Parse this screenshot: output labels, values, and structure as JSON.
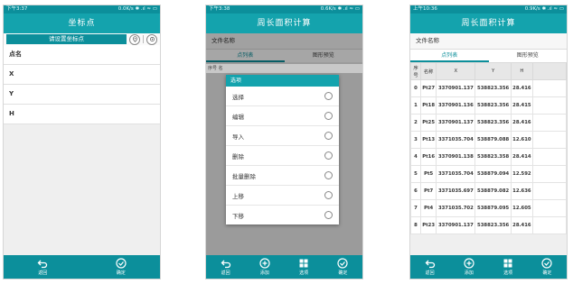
{
  "phone1": {
    "status_time": "下午3:37",
    "status_right": "0.0K/s ✱ .ıl ≈ ▭",
    "title": "坐标点",
    "set_button": "请设置坐标点",
    "fields": [
      "点名",
      "X",
      "Y",
      "H"
    ],
    "bottom": [
      {
        "label": "返回",
        "icon": "back-arrow-icon"
      },
      {
        "label": "确定",
        "icon": "check-circle-icon"
      }
    ]
  },
  "phone2": {
    "status_time": "下午3:38",
    "status_right": "0.6K/s ✱ .ıl ≈ ▭",
    "title": "周长面积计算",
    "filename_label": "文件名称",
    "tabs": [
      "点列表",
      "图形预览"
    ],
    "header_stub": "序号  名",
    "dialog_title": "选项",
    "options": [
      "选择",
      "编辑",
      "导入",
      "删除",
      "批量删除",
      "上移",
      "下移"
    ],
    "bottom": [
      {
        "label": "返回",
        "icon": "back-arrow-icon"
      },
      {
        "label": "添加",
        "icon": "plus-circle-icon"
      },
      {
        "label": "选项",
        "icon": "grid-icon"
      },
      {
        "label": "确定",
        "icon": "check-circle-icon"
      }
    ]
  },
  "phone3": {
    "status_time": "上午10:36",
    "status_right": "0.9K/s ✱ .ıl ≈ ▭",
    "title": "周长面积计算",
    "filename_label": "文件名称",
    "tabs": [
      "点列表",
      "图形预览"
    ],
    "columns": [
      "序号",
      "名称",
      "X",
      "Y",
      "H"
    ],
    "rows": [
      [
        "0",
        "Pt27",
        "3370901.137",
        "538823.356",
        "28.416"
      ],
      [
        "1",
        "Pt18",
        "3370901.136",
        "538823.356",
        "28.415"
      ],
      [
        "2",
        "Pt25",
        "3370901.137",
        "538823.356",
        "28.416"
      ],
      [
        "3",
        "Pt13",
        "3371035.704",
        "538879.088",
        "12.610"
      ],
      [
        "4",
        "Pt16",
        "3370901.138",
        "538823.358",
        "28.414"
      ],
      [
        "5",
        "Pt5",
        "3371035.704",
        "538879.094",
        "12.592"
      ],
      [
        "6",
        "Pt7",
        "3371035.697",
        "538879.082",
        "12.636"
      ],
      [
        "7",
        "Pt4",
        "3371035.702",
        "538879.095",
        "12.605"
      ],
      [
        "8",
        "Pt23",
        "3370901.137",
        "538823.356",
        "28.416"
      ]
    ],
    "bottom": [
      {
        "label": "返回",
        "icon": "back-arrow-icon"
      },
      {
        "label": "添加",
        "icon": "plus-circle-icon"
      },
      {
        "label": "选项",
        "icon": "grid-icon"
      },
      {
        "label": "确定",
        "icon": "check-circle-icon"
      }
    ]
  }
}
